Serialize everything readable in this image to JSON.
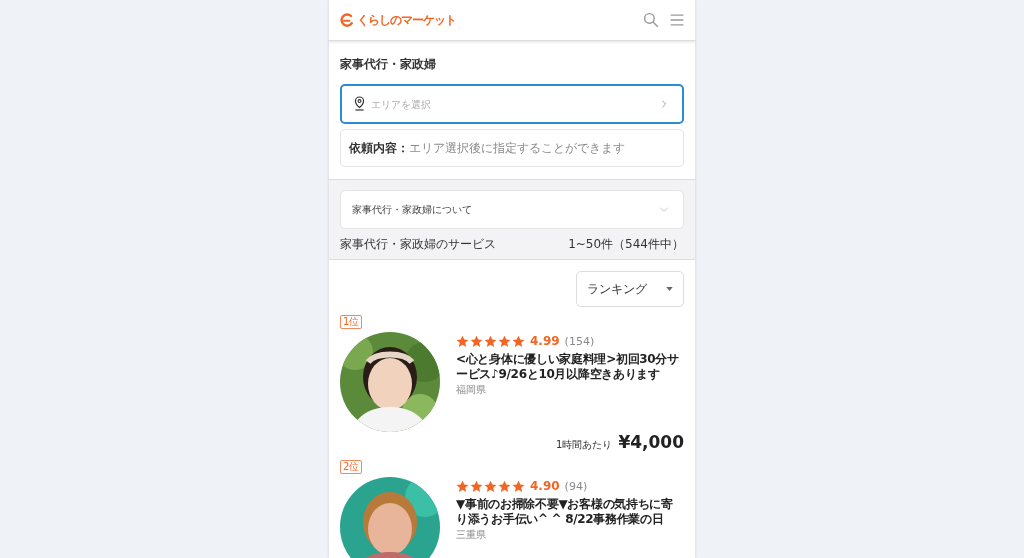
{
  "header": {
    "logo": "くらしのマーケット"
  },
  "category": {
    "title": "家事代行・家政婦"
  },
  "area_field": {
    "placeholder": "エリアを選択"
  },
  "request": {
    "label": "依頼内容：",
    "hint": "エリア選択後に指定することができます"
  },
  "about": {
    "label": "家事代行・家政婦について",
    "expanded": false
  },
  "services": {
    "title": "家事代行・家政婦のサービス",
    "count": "1~50件（544件中）"
  },
  "sort": {
    "value": "ランキング"
  },
  "listings": [
    {
      "rank": "1位",
      "stars": 5,
      "rating": "4.99",
      "reviews": "(154)",
      "title": "<心と身体に優しい家庭料理>初回30分サービス♪9/26と10月以降空きあります",
      "location": "福岡県",
      "price_unit": "1時間あたり",
      "price": "¥4,000",
      "kind": "picture"
    },
    {
      "rank": "2位",
      "stars": 5,
      "rating": "4.90",
      "reviews": "(94)",
      "title": "▼事前のお掃除不要▼お客様の気持ちに寄り添うお手伝い^ ^ 8/22事務作業の日",
      "location": "三重県",
      "kind": "picture"
    }
  ]
}
